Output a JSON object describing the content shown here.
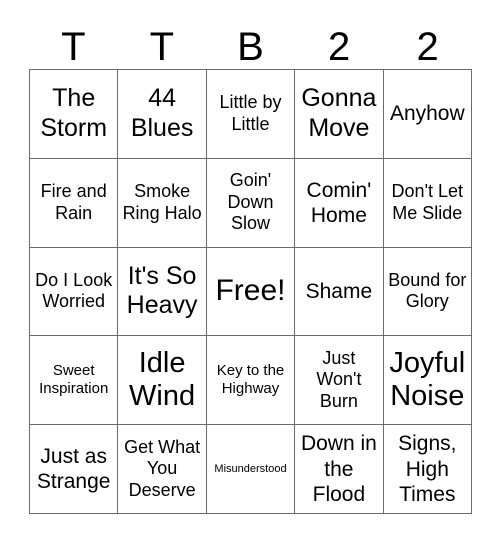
{
  "card": {
    "header": {
      "letters": [
        "T",
        "T",
        "B",
        "2",
        "2"
      ]
    },
    "colors": {
      "background": "#ffffff",
      "grid_line": "#6b6b6b",
      "text": "#000000"
    },
    "rows": [
      [
        {
          "text": "The Storm",
          "size": "xl"
        },
        {
          "text": "44 Blues",
          "size": "xl"
        },
        {
          "text": "Little by Little",
          "size": "md"
        },
        {
          "text": "Gonna Move",
          "size": "xl"
        },
        {
          "text": "Anyhow",
          "size": "lg"
        }
      ],
      [
        {
          "text": "Fire and Rain",
          "size": "md"
        },
        {
          "text": "Smoke Ring Halo",
          "size": "md"
        },
        {
          "text": "Goin' Down Slow",
          "size": "md"
        },
        {
          "text": "Comin' Home",
          "size": "lg"
        },
        {
          "text": "Don't Let Me Slide",
          "size": "md"
        }
      ],
      [
        {
          "text": "Do I Look Worried",
          "size": "md"
        },
        {
          "text": "It's So Heavy",
          "size": "xl"
        },
        {
          "text": "Free!",
          "size": "free"
        },
        {
          "text": "Shame",
          "size": "lg"
        },
        {
          "text": "Bound for Glory",
          "size": "md"
        }
      ],
      [
        {
          "text": "Sweet Inspiration",
          "size": "sm"
        },
        {
          "text": "Idle Wind",
          "size": "2xl"
        },
        {
          "text": "Key to the Highway",
          "size": "sm"
        },
        {
          "text": "Just Won't Burn",
          "size": "md"
        },
        {
          "text": "Joyful Noise",
          "size": "2xl"
        }
      ],
      [
        {
          "text": "Just as Strange",
          "size": "lg"
        },
        {
          "text": "Get What You Deserve",
          "size": "md"
        },
        {
          "text": "Misunderstood",
          "size": "xs"
        },
        {
          "text": "Down in the Flood",
          "size": "lg"
        },
        {
          "text": "Signs, High Times",
          "size": "lg"
        }
      ]
    ]
  }
}
